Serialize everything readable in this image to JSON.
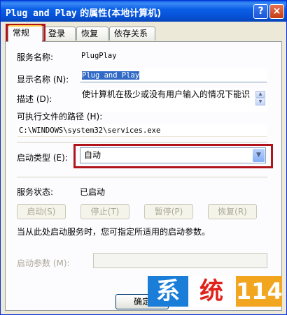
{
  "window": {
    "title_prefix": "Plug and Play",
    "title_suffix": " 的属性(本地计算机)",
    "help_label": "?",
    "close_label": "×"
  },
  "tabs": [
    {
      "label": "常规",
      "active": true
    },
    {
      "label": "登录"
    },
    {
      "label": "恢复"
    },
    {
      "label": "依存关系"
    }
  ],
  "general": {
    "service_name_label": "服务名称:",
    "service_name_value": "PlugPlay",
    "display_name_label": "显示名称 (N):",
    "display_name_value": "Plug and Play",
    "description_label": "描述 (D):",
    "description_value": "使计算机在极少或没有用户输入的情况下能识",
    "exe_path_label": "可执行文件的路径 (H):",
    "exe_path_value": "C:\\WINDOWS\\system32\\services.exe",
    "startup_type_label": "启动类型 (E):",
    "startup_type_value": "自动",
    "service_status_label": "服务状态:",
    "service_status_value": "已启动",
    "buttons": {
      "start": "启动(S)",
      "stop": "停止(T)",
      "pause": "暂停(P)",
      "resume": "恢复(R)"
    },
    "hint_text": "当从此处启动服务时，您可指定所适用的启动参数。",
    "start_params_label": "启动参数 (M):",
    "start_params_value": ""
  },
  "footer": {
    "ok_label": "确定"
  },
  "watermark": {
    "char1": "系",
    "char2": "统",
    "num": "114",
    "colors": {
      "blue": "#1A7ED9",
      "red": "#E0221C",
      "orange": "#F2A51F"
    }
  },
  "highlight_color": "#B0141A"
}
